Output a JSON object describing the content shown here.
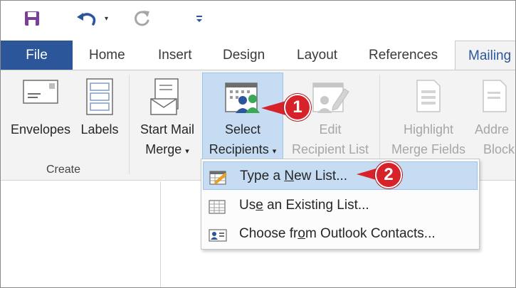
{
  "qat": {
    "save_icon": "save-icon",
    "undo_icon": "undo-icon",
    "redo_icon": "redo-icon",
    "customize_icon": "customize-icon",
    "undo_dropdown": "▾",
    "customize_glyph": "▾"
  },
  "tabs": [
    {
      "label": "File"
    },
    {
      "label": "Home"
    },
    {
      "label": "Insert"
    },
    {
      "label": "Design"
    },
    {
      "label": "Layout"
    },
    {
      "label": "References"
    },
    {
      "label": "Mailing"
    }
  ],
  "ribbon": {
    "envelopes": "Envelopes",
    "labels": "Labels",
    "start_mail_line1": "Start Mail",
    "start_mail_line2": "Merge",
    "select_line1": "Select",
    "select_line2": "Recipients",
    "edit_line1": "Edit",
    "edit_line2": "Recipient List",
    "highlight_line1": "Highlight",
    "highlight_line2": "Merge Fields",
    "address_line1": "Addre",
    "address_line2": "Block",
    "group_create": "Create",
    "dropdown_caret": "▾"
  },
  "menu": {
    "items": [
      {
        "pre": "Type a ",
        "accel": "N",
        "post": "ew List..."
      },
      {
        "pre": "Us",
        "accel": "e",
        "post": " an Existing List..."
      },
      {
        "pre": "Choose fr",
        "accel": "o",
        "post": "m Outlook Contacts..."
      }
    ]
  },
  "callouts": {
    "one": "1",
    "two": "2"
  },
  "colors": {
    "accent": "#2b579a",
    "highlight": "#c5dcf3",
    "callout": "#d8222a"
  }
}
